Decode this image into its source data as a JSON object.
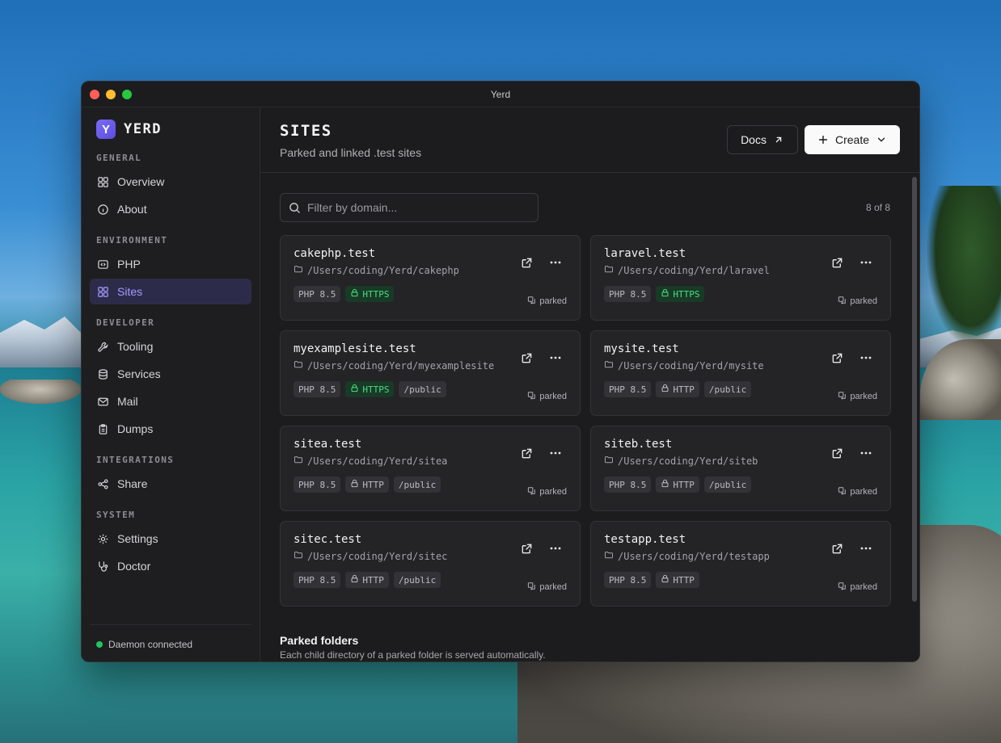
{
  "window": {
    "title": "Yerd"
  },
  "brand": {
    "logo_letter": "Y",
    "name": "YERD"
  },
  "sidebar": {
    "sections": [
      {
        "label": "GENERAL",
        "items": [
          {
            "label": "Overview",
            "icon": "grid-icon"
          },
          {
            "label": "About",
            "icon": "info-icon"
          }
        ]
      },
      {
        "label": "ENVIRONMENT",
        "items": [
          {
            "label": "PHP",
            "icon": "code-icon"
          },
          {
            "label": "Sites",
            "icon": "grid-icon",
            "active": true
          }
        ]
      },
      {
        "label": "DEVELOPER",
        "items": [
          {
            "label": "Tooling",
            "icon": "wrench-icon"
          },
          {
            "label": "Services",
            "icon": "database-icon"
          },
          {
            "label": "Mail",
            "icon": "mail-icon"
          },
          {
            "label": "Dumps",
            "icon": "clipboard-icon"
          }
        ]
      },
      {
        "label": "INTEGRATIONS",
        "items": [
          {
            "label": "Share",
            "icon": "share-icon"
          }
        ]
      },
      {
        "label": "SYSTEM",
        "items": [
          {
            "label": "Settings",
            "icon": "gear-icon"
          },
          {
            "label": "Doctor",
            "icon": "stethoscope-icon"
          }
        ]
      }
    ],
    "footer": {
      "status": "Daemon connected",
      "status_color": "#22c55e"
    }
  },
  "header": {
    "title": "SITES",
    "subtitle": "Parked and linked .test sites",
    "docs_label": "Docs",
    "create_label": "Create"
  },
  "filter": {
    "placeholder": "Filter by domain...",
    "value": ""
  },
  "count": "8 of 8",
  "sites": [
    {
      "name": "cakephp.test",
      "path": "/Users/coding/Yerd/cakephp",
      "php": "PHP 8.5",
      "protocol": "HTTPS",
      "secure": true,
      "public": "",
      "status": "parked"
    },
    {
      "name": "laravel.test",
      "path": "/Users/coding/Yerd/laravel",
      "php": "PHP 8.5",
      "protocol": "HTTPS",
      "secure": true,
      "public": "",
      "status": "parked"
    },
    {
      "name": "myexamplesite.test",
      "path": "/Users/coding/Yerd/myexamplesite",
      "php": "PHP 8.5",
      "protocol": "HTTPS",
      "secure": true,
      "public": "/public",
      "status": "parked"
    },
    {
      "name": "mysite.test",
      "path": "/Users/coding/Yerd/mysite",
      "php": "PHP 8.5",
      "protocol": "HTTP",
      "secure": false,
      "public": "/public",
      "status": "parked"
    },
    {
      "name": "sitea.test",
      "path": "/Users/coding/Yerd/sitea",
      "php": "PHP 8.5",
      "protocol": "HTTP",
      "secure": false,
      "public": "/public",
      "status": "parked"
    },
    {
      "name": "siteb.test",
      "path": "/Users/coding/Yerd/siteb",
      "php": "PHP 8.5",
      "protocol": "HTTP",
      "secure": false,
      "public": "/public",
      "status": "parked"
    },
    {
      "name": "sitec.test",
      "path": "/Users/coding/Yerd/sitec",
      "php": "PHP 8.5",
      "protocol": "HTTP",
      "secure": false,
      "public": "/public",
      "status": "parked"
    },
    {
      "name": "testapp.test",
      "path": "/Users/coding/Yerd/testapp",
      "php": "PHP 8.5",
      "protocol": "HTTP",
      "secure": false,
      "public": "",
      "status": "parked"
    }
  ],
  "parked_folders": {
    "title": "Parked folders",
    "subtitle": "Each child directory of a parked folder is served automatically."
  },
  "colors": {
    "accent": "#a79bff",
    "https": "#4ade80",
    "background": "#1c1c1e"
  }
}
